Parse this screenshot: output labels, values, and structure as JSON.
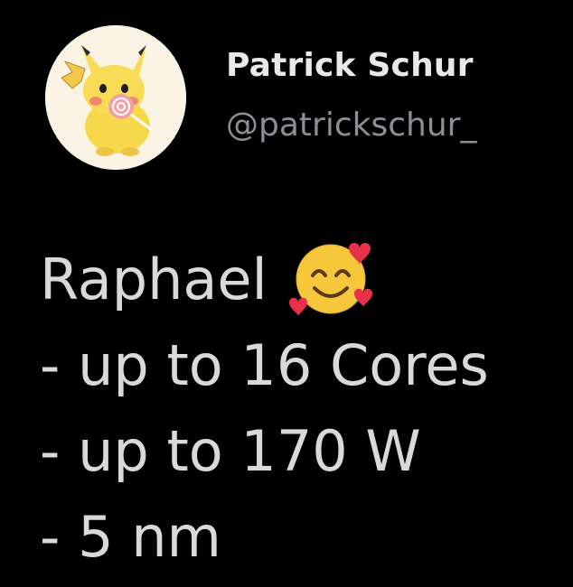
{
  "tweet": {
    "author_name": "Patrick Schur",
    "author_handle": "@patrickschur_",
    "avatar_icon": "pikachu-avatar",
    "lines": [
      "Raphael",
      "- up to 16 Cores",
      "- up to 170 W",
      "- 5 nm"
    ],
    "emoji": "smiling-face-with-hearts"
  },
  "colors": {
    "background": "#000000",
    "name": "#e9e9e9",
    "handle": "#8b8f93",
    "text": "#d9d9d9"
  }
}
